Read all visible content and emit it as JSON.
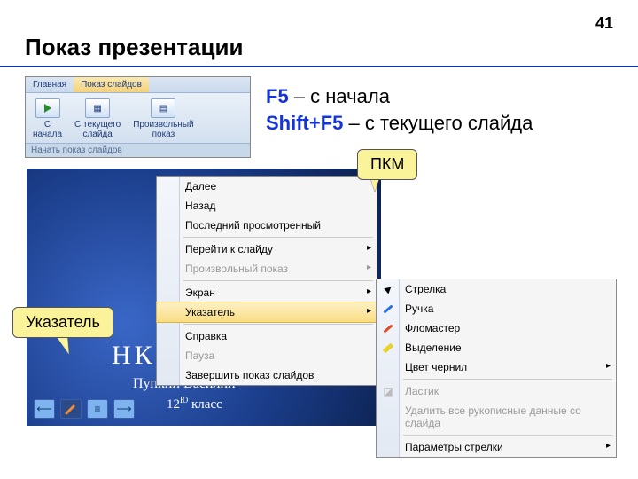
{
  "page_number": "41",
  "title": "Показ презентации",
  "ribbon": {
    "tabs": {
      "home": "Главная",
      "slideshow": "Показ слайдов"
    },
    "buttons": {
      "from_start": "С\nначала",
      "from_current": "С текущего\nслайда",
      "custom": "Произвольный\nпоказ"
    },
    "caption": "Начать показ слайдов"
  },
  "shortcuts": {
    "f5_key": "F5",
    "f5_text": " – с начала",
    "shift_key": "Shift+F5",
    "shift_text": " – с текущего слайда"
  },
  "callouts": {
    "pkm": "ПКМ",
    "pointer": "Указатель"
  },
  "slide": {
    "title_fragment": "НКТ",
    "sub1": "Пупкин Василий",
    "sub2_pre": "12",
    "sub2_sup": "Ю",
    "sub2_post": " класс"
  },
  "context_menu": {
    "next": "Далее",
    "back": "Назад",
    "last_viewed": "Последний просмотренный",
    "goto": "Перейти к слайду",
    "custom_show": "Произвольный показ",
    "screen": "Экран",
    "pointer": "Указатель",
    "help": "Справка",
    "pause": "Пауза",
    "end": "Завершить показ слайдов"
  },
  "submenu": {
    "arrow": "Стрелка",
    "pen": "Ручка",
    "marker": "Фломастер",
    "highlight": "Выделение",
    "ink_color": "Цвет чернил",
    "eraser": "Ластик",
    "erase_all": "Удалить все рукописные данные со слайда",
    "arrow_params": "Параметры стрелки"
  }
}
